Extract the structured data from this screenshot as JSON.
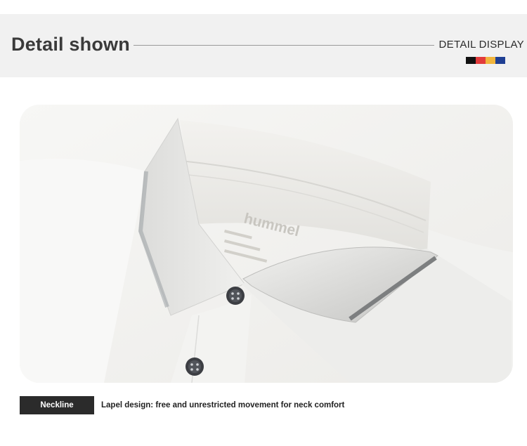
{
  "header": {
    "title": "Detail shown",
    "display_label": "DETAIL DISPLAY",
    "swatch_colors": [
      "#111111",
      "#e23b3b",
      "#f1b53d",
      "#1f3f93"
    ]
  },
  "photo": {
    "subject": "polo-shirt-collar",
    "brand_print": "hummel"
  },
  "caption": {
    "tag": "Neckline",
    "text": "Lapel design: free and unrestricted movement for neck comfort"
  }
}
